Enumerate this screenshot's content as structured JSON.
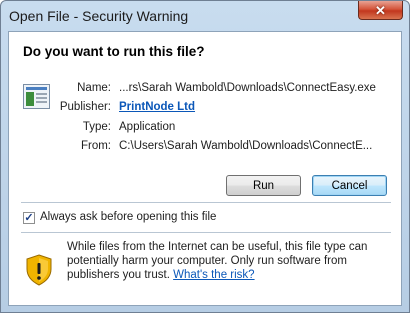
{
  "window": {
    "title": "Open File - Security Warning",
    "close_label": "✕"
  },
  "dialog": {
    "heading": "Do you want to run this file?",
    "file_icon": "application-window-icon",
    "fields": {
      "name_label": "Name:",
      "name_value": "...rs\\Sarah Wambold\\Downloads\\ConnectEasy.exe",
      "publisher_label": "Publisher:",
      "publisher_value": "PrintNode Ltd",
      "type_label": "Type:",
      "type_value": "Application",
      "from_label": "From:",
      "from_value": "C:\\Users\\Sarah Wambold\\Downloads\\ConnectE..."
    },
    "buttons": {
      "run": "Run",
      "cancel": "Cancel"
    },
    "always_ask": {
      "checked": true,
      "label": "Always ask before opening this file"
    },
    "warning": {
      "icon": "warning-shield-icon",
      "text": "While files from the Internet can be useful, this file type can potentially harm your computer. Only run software from publishers you trust.",
      "link": "What's the risk?"
    }
  },
  "colors": {
    "frame": "#b6cde4",
    "link": "#0b57b8",
    "close_button": "#c2371e",
    "warning_shield": "#f0b400"
  }
}
